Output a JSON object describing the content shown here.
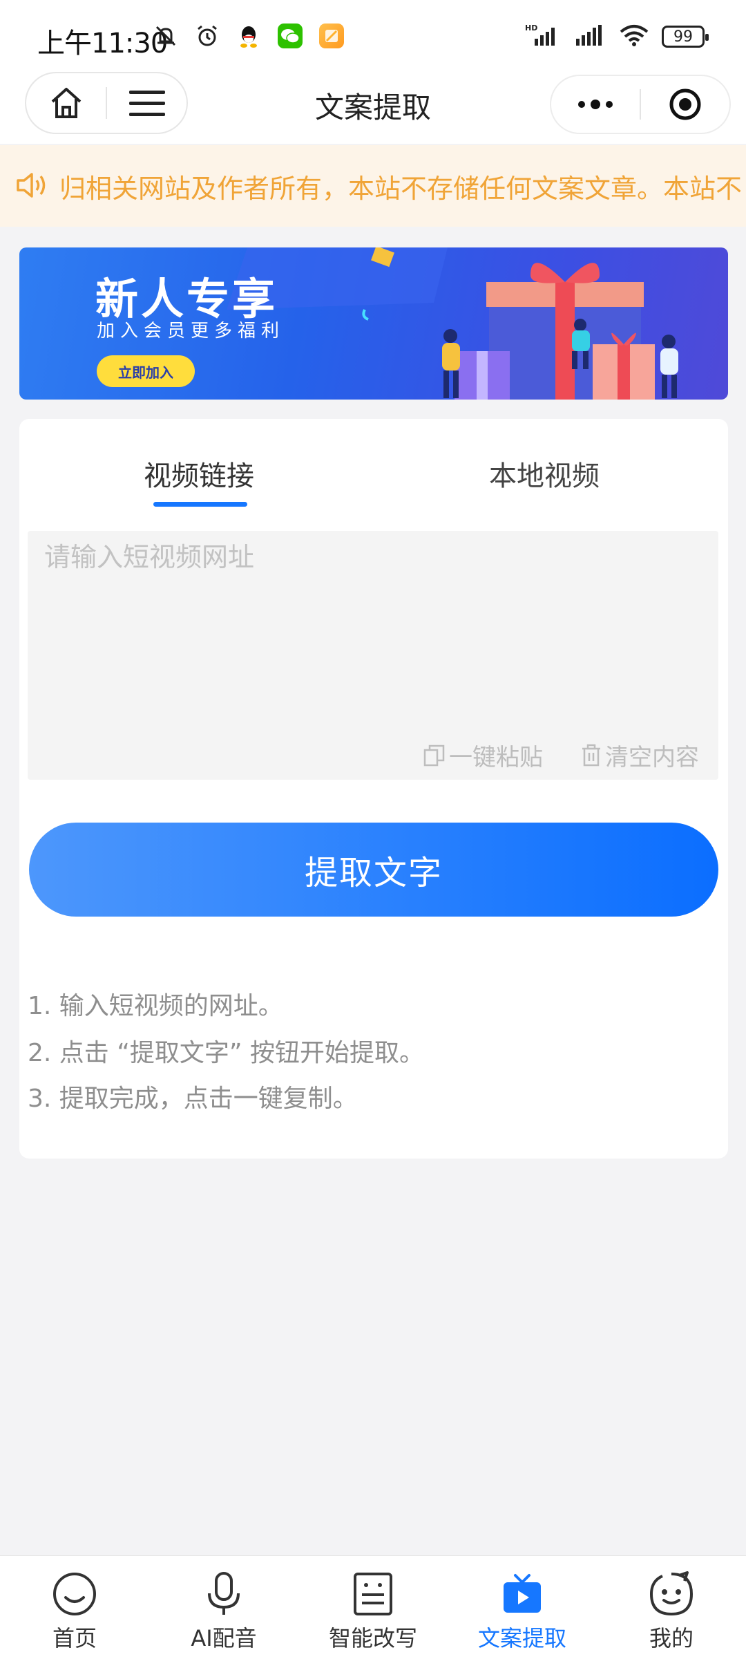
{
  "status_bar": {
    "time": "上午11:30",
    "battery": "99",
    "network_label": "HD"
  },
  "header": {
    "title": "文案提取"
  },
  "notice": {
    "text": "归相关网站及作者所有，本站不存储任何文案文章。本站不"
  },
  "banner": {
    "title": "新人专享",
    "subtitle": "加入会员更多福利",
    "button": "立即加入"
  },
  "tabs": [
    {
      "label": "视频链接",
      "active": true
    },
    {
      "label": "本地视频",
      "active": false
    }
  ],
  "url_input": {
    "placeholder": "请输入短视频网址",
    "value": ""
  },
  "actions": {
    "paste": "一键粘贴",
    "clear": "清空内容",
    "extract": "提取文字"
  },
  "instructions": [
    "1. 输入短视频的网址。",
    "2. 点击 “提取文字” 按钮开始提取。",
    "3. 提取完成，点击一键复制。"
  ],
  "bottom_nav": [
    {
      "label": "首页",
      "icon": "smile-icon",
      "active": false
    },
    {
      "label": "AI配音",
      "icon": "microphone-icon",
      "active": false
    },
    {
      "label": "智能改写",
      "icon": "document-edit-icon",
      "active": false
    },
    {
      "label": "文案提取",
      "icon": "video-play-icon",
      "active": true
    },
    {
      "label": "我的",
      "icon": "profile-face-icon",
      "active": false
    }
  ],
  "colors": {
    "accent": "#1677ff",
    "notice_text": "#f0a437",
    "notice_bg": "#fdf4e8"
  }
}
